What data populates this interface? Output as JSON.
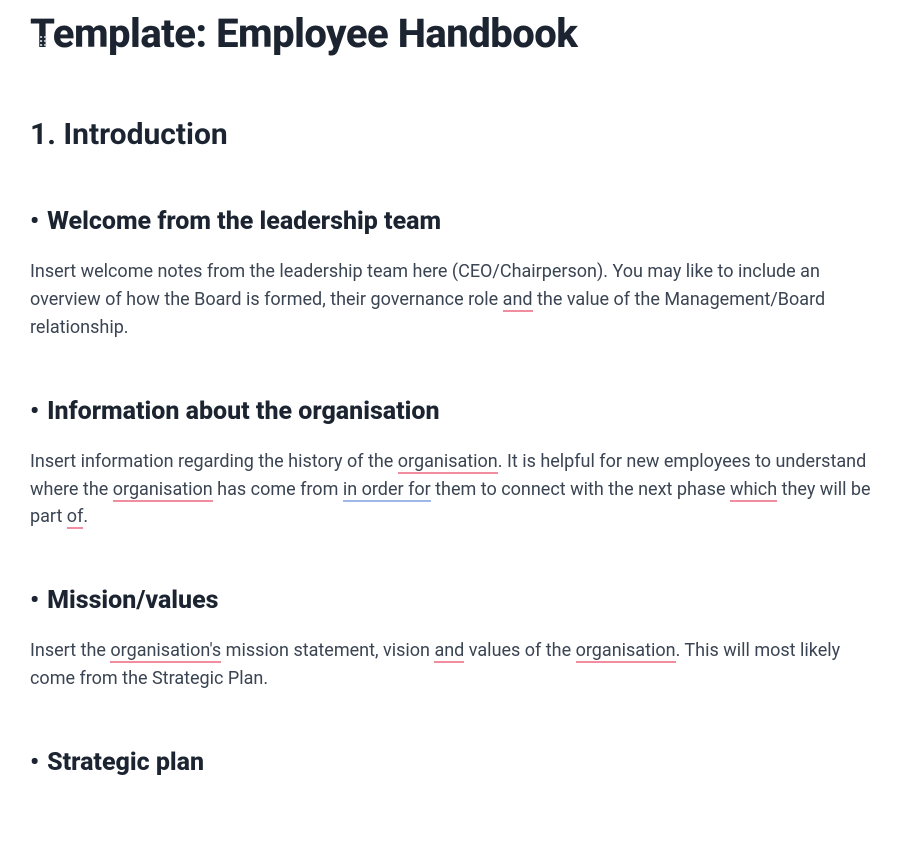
{
  "page_title": "Template: Employee Handbook",
  "section1": {
    "heading": "1. Introduction",
    "sub1": {
      "heading": "Welcome from the leadership team",
      "body_parts": [
        {
          "t": "Insert welcome notes from the leadership team here (CEO/Chairperson). You may like to include an overview of how the Board is formed, their governance role "
        },
        {
          "t": "and",
          "u": "red"
        },
        {
          "t": " the value of the Management/Board relationship."
        }
      ]
    },
    "sub2": {
      "heading": "Information about the organisation",
      "body_parts": [
        {
          "t": "Insert information regarding the history of the "
        },
        {
          "t": "organisation",
          "u": "red"
        },
        {
          "t": ". It is helpful for new employees to understand where the "
        },
        {
          "t": "organisation",
          "u": "red"
        },
        {
          "t": " has come from "
        },
        {
          "t": "in order for",
          "u": "blue"
        },
        {
          "t": " them to connect with the next phase "
        },
        {
          "t": "which",
          "u": "red"
        },
        {
          "t": " they will be part "
        },
        {
          "t": "of",
          "u": "red"
        },
        {
          "t": "."
        }
      ]
    },
    "sub3": {
      "heading": "Mission/values",
      "body_parts": [
        {
          "t": "Insert the "
        },
        {
          "t": "organisation's",
          "u": "red"
        },
        {
          "t": " mission statement, vision "
        },
        {
          "t": "and",
          "u": "red"
        },
        {
          "t": " values of the "
        },
        {
          "t": "organisation",
          "u": "red"
        },
        {
          "t": ". This will most likely come from the Strategic Plan."
        }
      ]
    },
    "sub4": {
      "heading": "Strategic plan"
    }
  }
}
